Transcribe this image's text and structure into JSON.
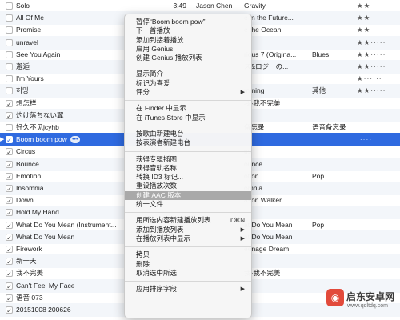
{
  "rows": [
    {
      "checked": false,
      "title": "Solo",
      "time": "3:49",
      "artist": "Jason Chen",
      "album": "Gravity",
      "genre": "",
      "rating": "★★·····"
    },
    {
      "checked": false,
      "title": "All Of Me",
      "time": "",
      "artist": "",
      "album": "e in the Future...",
      "genre": "",
      "rating": "★★·····"
    },
    {
      "checked": false,
      "title": "Promise",
      "time": "",
      "artist": "",
      "album": "e the Ocean",
      "genre": "",
      "rating": "★★·····"
    },
    {
      "checked": false,
      "title": "unravel",
      "time": "",
      "artist": "",
      "album": "",
      "genre": "",
      "rating": "★★·····"
    },
    {
      "checked": false,
      "title": "See You Again",
      "time": "",
      "artist": "",
      "album": "rious 7 (Origina...",
      "genre": "Blues",
      "rating": "★★·····"
    },
    {
      "checked": false,
      "title": "邂逅",
      "time": "",
      "artist": "",
      "album": "ス&ロジーの...",
      "genre": "",
      "rating": "★★·····"
    },
    {
      "checked": false,
      "title": "I'm Yours",
      "time": "",
      "artist": "",
      "album": "",
      "genre": "",
      "rating": "★······"
    },
    {
      "checked": false,
      "title": "허밍",
      "time": "",
      "artist": "",
      "album": "mming",
      "genre": "其他",
      "rating": "★★·····"
    },
    {
      "checked": true,
      "title": "想怎样",
      "time": "",
      "artist": "",
      "album": "我-我不完美",
      "genre": "",
      "rating": ""
    },
    {
      "checked": true,
      "title": "灼け落ちない翼",
      "time": "",
      "artist": "",
      "album": "",
      "genre": "",
      "rating": ""
    },
    {
      "checked": false,
      "title": "好久不见jcyhb",
      "time": "",
      "artist": "",
      "album": "备忘录",
      "genre": "语音备忘录",
      "rating": ""
    },
    {
      "checked": true,
      "title": "Boom boom pow",
      "time": "",
      "artist": "",
      "album": "",
      "genre": "",
      "rating": "·····",
      "selected": true
    },
    {
      "checked": true,
      "title": "Circus",
      "time": "",
      "artist": "",
      "album": "us",
      "genre": "",
      "rating": ""
    },
    {
      "checked": true,
      "title": "Bounce",
      "time": "",
      "artist": "",
      "album": "ounce",
      "genre": "",
      "rating": ""
    },
    {
      "checked": true,
      "title": "Emotion",
      "time": "",
      "artist": "",
      "album": "otion",
      "genre": "Pop",
      "rating": ""
    },
    {
      "checked": true,
      "title": "Insomnia",
      "time": "",
      "artist": "",
      "album": "omnia",
      "genre": "",
      "rating": ""
    },
    {
      "checked": true,
      "title": "Down",
      "time": "",
      "artist": "",
      "album": "ason Walker",
      "genre": "",
      "rating": ""
    },
    {
      "checked": true,
      "title": "Hold My Hand",
      "time": "",
      "artist": "",
      "album": "",
      "genre": "",
      "rating": ""
    },
    {
      "checked": true,
      "title": "What Do You Mean (Instrument...",
      "time": "",
      "artist": "",
      "album": "at Do You Mean",
      "genre": "Pop",
      "rating": ""
    },
    {
      "checked": true,
      "title": "What Do You Mean",
      "time": "",
      "artist": "",
      "album": "at Do You Mean",
      "genre": "",
      "rating": ""
    },
    {
      "checked": true,
      "title": "Firework",
      "time": "",
      "artist": "",
      "album": "eenage Dream",
      "genre": "",
      "rating": ""
    },
    {
      "checked": true,
      "title": "新一天",
      "time": "",
      "artist": "",
      "album": "",
      "genre": "",
      "rating": ""
    },
    {
      "checked": true,
      "title": "我不完美",
      "time": "",
      "artist": "",
      "album": "我-我不完美",
      "genre": "",
      "rating": ""
    },
    {
      "checked": true,
      "title": "Can't Feel My Face",
      "time": "",
      "artist": "",
      "album": "",
      "genre": "",
      "rating": ""
    },
    {
      "checked": true,
      "title": "语音 073",
      "time": "",
      "artist": "",
      "album": "",
      "genre": "",
      "rating": ""
    },
    {
      "checked": true,
      "title": "20151008 200626",
      "time": "",
      "artist": "",
      "album": "",
      "genre": "",
      "rating": ""
    }
  ],
  "context_menu": [
    {
      "label": "暂停“Boom boom pow”"
    },
    {
      "label": "下一首播放"
    },
    {
      "label": "添加到接着播放"
    },
    {
      "label": "启用 Genius"
    },
    {
      "label": "创建 Genius 播放列表"
    },
    {
      "sep": true
    },
    {
      "label": "显示简介"
    },
    {
      "label": "标记为喜爱"
    },
    {
      "label": "评分",
      "submenu": true
    },
    {
      "sep": true
    },
    {
      "label": "在 Finder 中显示"
    },
    {
      "label": "在 iTunes Store 中显示"
    },
    {
      "sep": true
    },
    {
      "label": "按歌曲新建电台"
    },
    {
      "label": "按表演者新建电台"
    },
    {
      "sep": true
    },
    {
      "label": "获得专辑插图"
    },
    {
      "label": "获得音轨名称"
    },
    {
      "label": "转换 ID3 标记..."
    },
    {
      "label": "重设播放次数"
    },
    {
      "label": "创建 AAC 版本",
      "highlighted": true
    },
    {
      "label": "统一文件..."
    },
    {
      "sep": true
    },
    {
      "label": "用所选内容新建播放列表",
      "shortcut": "⇧⌘N"
    },
    {
      "label": "添加到播放列表",
      "submenu": true
    },
    {
      "label": "在播放列表中显示",
      "submenu": true
    },
    {
      "sep": true
    },
    {
      "label": "拷贝"
    },
    {
      "label": "删除"
    },
    {
      "label": "取消选中所选"
    },
    {
      "sep": true
    },
    {
      "label": "应用排序字段",
      "submenu": true
    }
  ],
  "watermark": {
    "logo_glyph": "◉",
    "name": "启东安卓网",
    "url": "www.qdltdq.com"
  },
  "glyphs": {
    "check": "✓",
    "arrow": "▶",
    "more": "•••",
    "play": "▶"
  }
}
